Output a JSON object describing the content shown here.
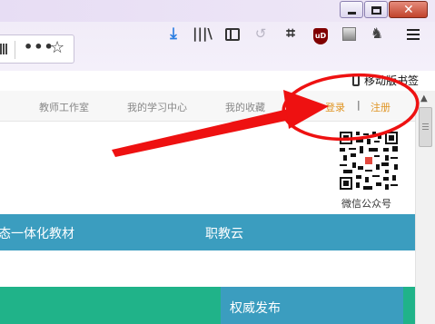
{
  "toolbar": {
    "overflow_icon": "•••",
    "bookmark_star": "☆",
    "download_icon": "⤓",
    "library_icon": "|||\\",
    "crop_icon": "⌗",
    "ublock_label": "uD",
    "evernote_icon": "♞",
    "dimmed_icon": "↺",
    "mobile_bookmarks": "移动版书签"
  },
  "topnav": {
    "links": [
      "教师工作室",
      "我的学习中心",
      "我的收藏"
    ],
    "login": "登录",
    "divider": "|",
    "register": "注册"
  },
  "qr": {
    "caption": "微信公众号"
  },
  "blue_band": {
    "left": "态一体化教材",
    "right": "职教云"
  },
  "authority": {
    "label": "权威发布"
  },
  "colors": {
    "accent_blue": "#3b9dbf",
    "accent_green": "#20b389",
    "link_orange": "#e09524",
    "annotation_red": "#ee1111"
  }
}
